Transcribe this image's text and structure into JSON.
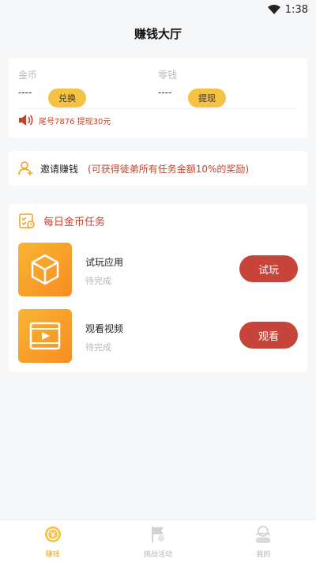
{
  "status_bar": {
    "time": "1:38",
    "wifi_icon": "wifi-icon"
  },
  "header": {
    "title": "赚钱大厅"
  },
  "wallet": {
    "coins": {
      "label": "金币",
      "value": "----",
      "button_label": "兑换"
    },
    "change": {
      "label": "零钱",
      "value": "----",
      "button_label": "提现"
    },
    "notice": {
      "icon": "speaker-icon",
      "text": "尾号7876 提现30元"
    }
  },
  "invite": {
    "icon": "user-add-icon",
    "label": "邀请赚钱",
    "note": "(可获得徒弟所有任务金额10%的奖励)"
  },
  "tasks": {
    "icon": "task-list-icon",
    "title": "每日金币任务",
    "items": [
      {
        "icon": "cube-icon",
        "name": "试玩应用",
        "status": "待完成",
        "button_label": "试玩"
      },
      {
        "icon": "video-icon",
        "name": "观看视频",
        "status": "待完成",
        "button_label": "观看"
      }
    ]
  },
  "tab_bar": {
    "tabs": [
      {
        "label": "赚钱",
        "icon": "coin-icon",
        "active": true
      },
      {
        "label": "挑战活动",
        "icon": "flag-icon",
        "active": false
      },
      {
        "label": "我的",
        "icon": "profile-icon",
        "active": false
      }
    ]
  },
  "colors": {
    "accent_red": "#c7443a",
    "accent_yellow": "#f6c244",
    "icon_orange": "#f78c22"
  }
}
